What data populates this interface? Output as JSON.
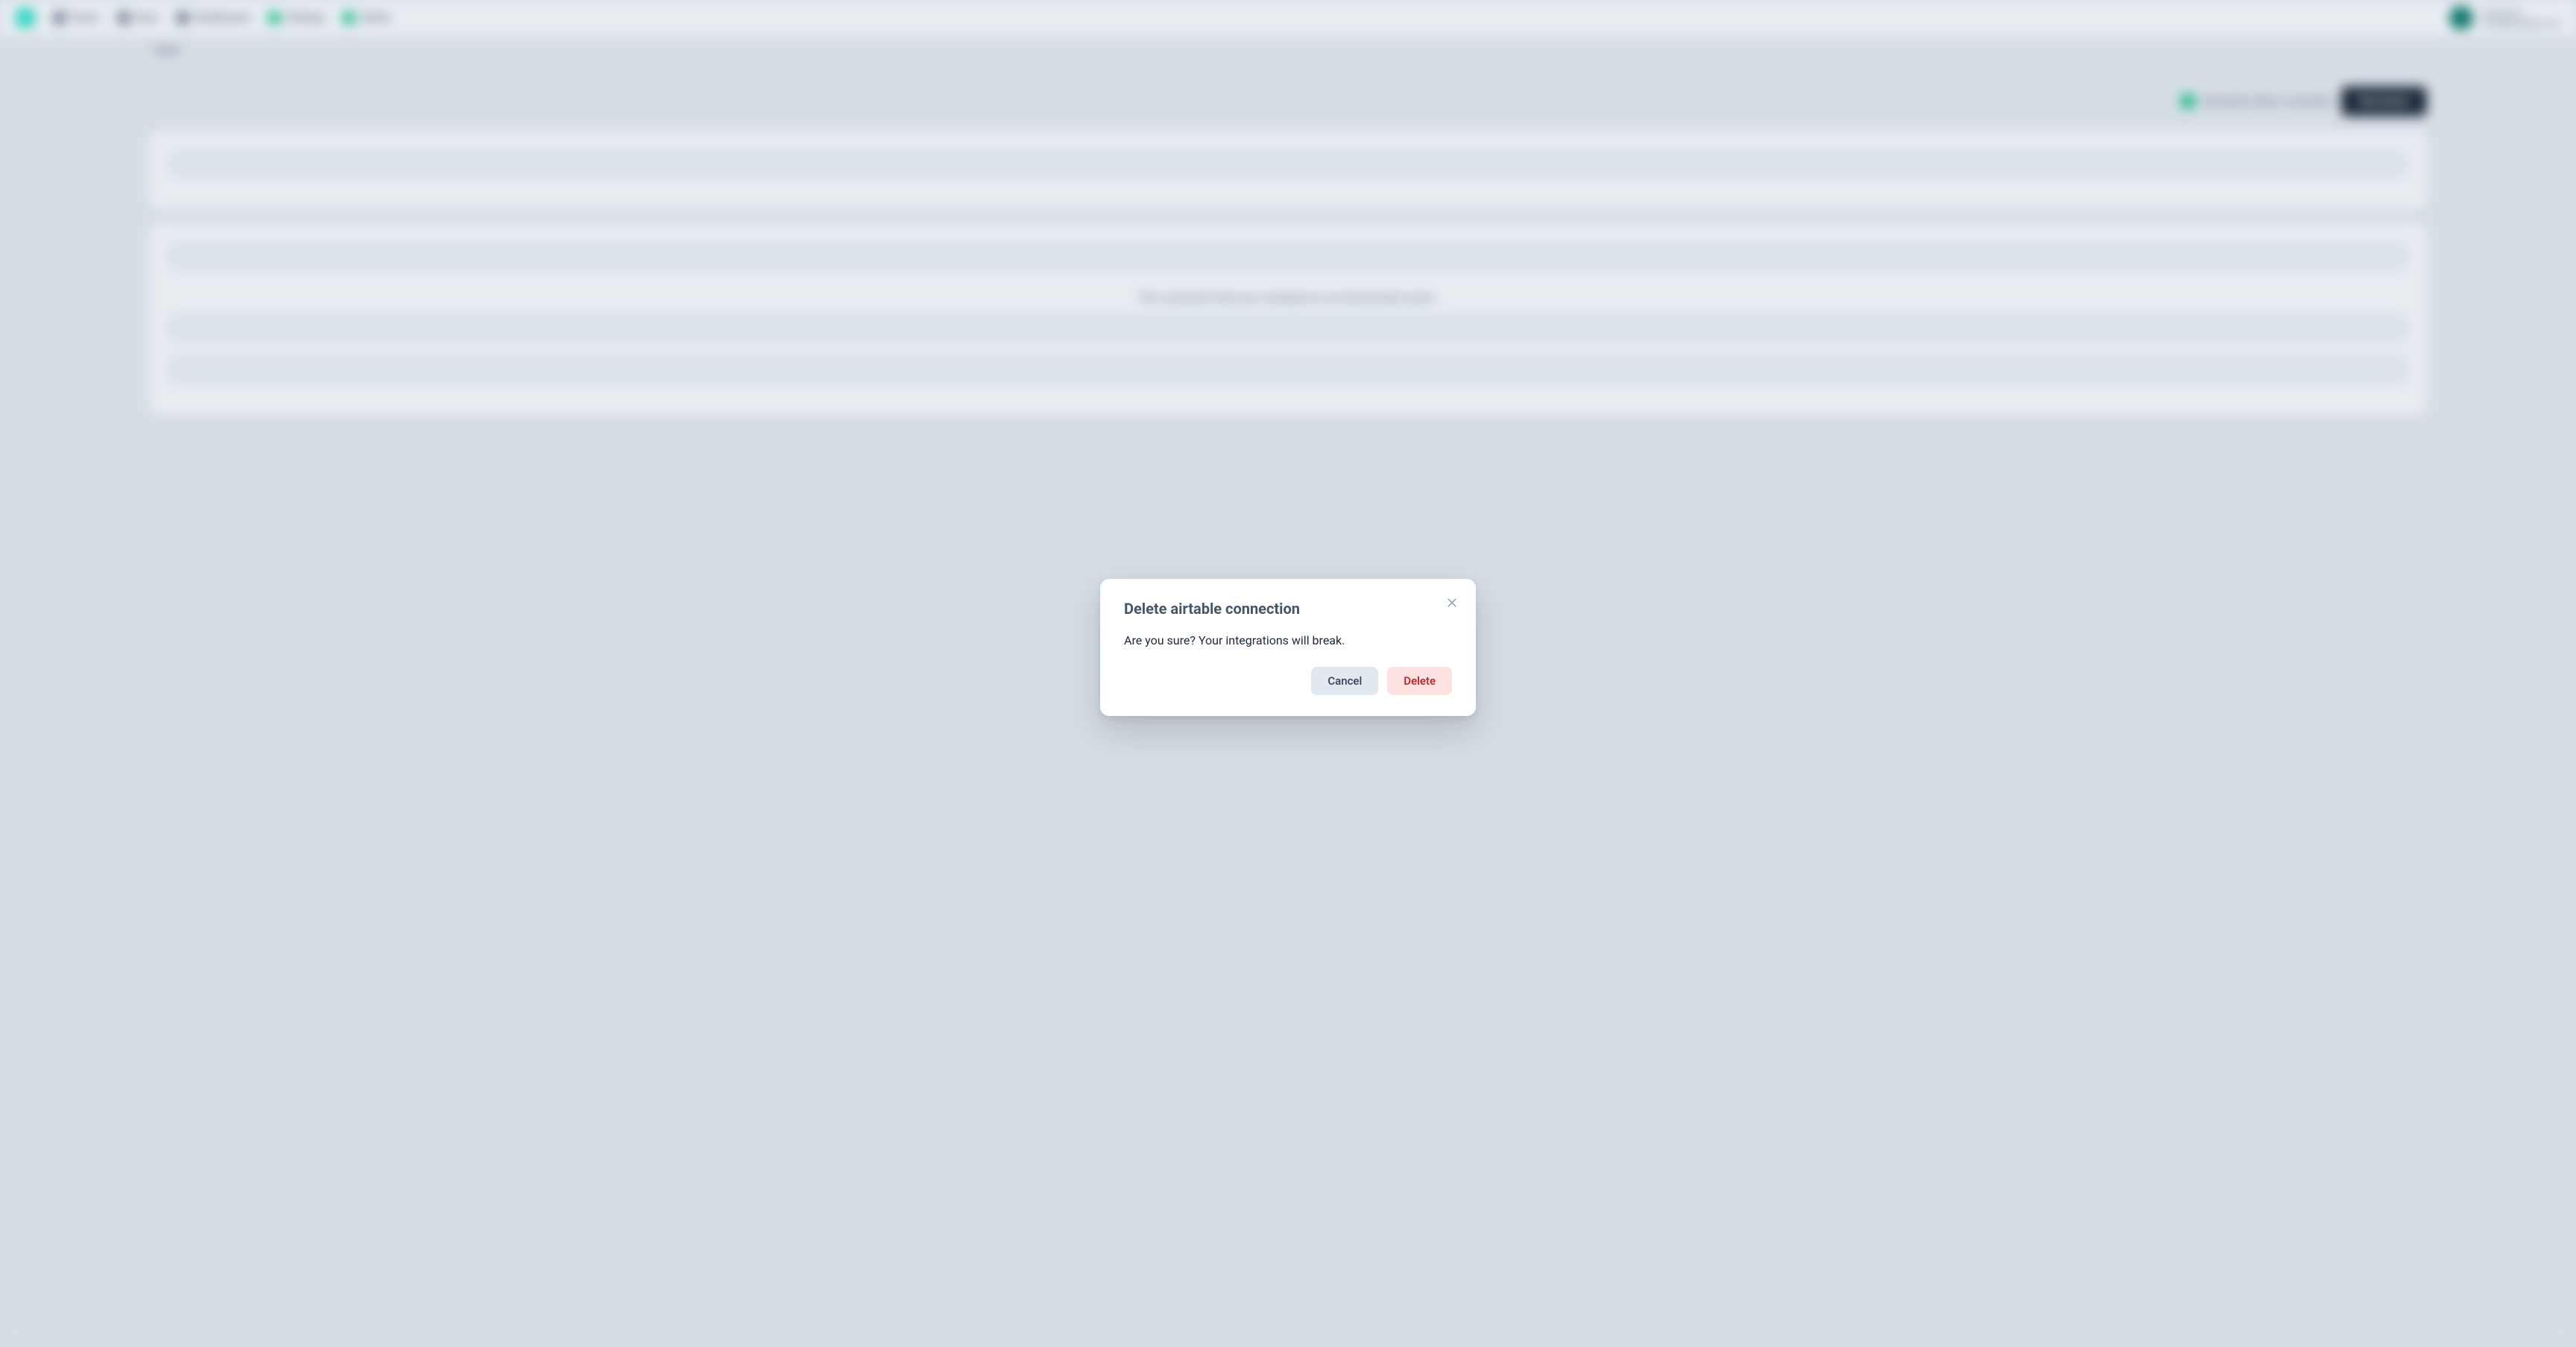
{
  "header": {
    "nav": {
      "home": "Home",
      "runs": "Runs",
      "dashboards": "Dashboards",
      "settings": "Settings",
      "admin": "Admin"
    },
    "user": {
      "name": "username",
      "email": "user@example.com"
    }
  },
  "page": {
    "back_label": "Back",
    "status_text": "Connection status: connected",
    "primary_button": "Reconnect",
    "info_text": "This connection links your workspace to an external data source."
  },
  "modal": {
    "title": "Delete airtable connection",
    "body": "Are you sure? Your integrations will break.",
    "cancel_label": "Cancel",
    "delete_label": "Delete"
  }
}
